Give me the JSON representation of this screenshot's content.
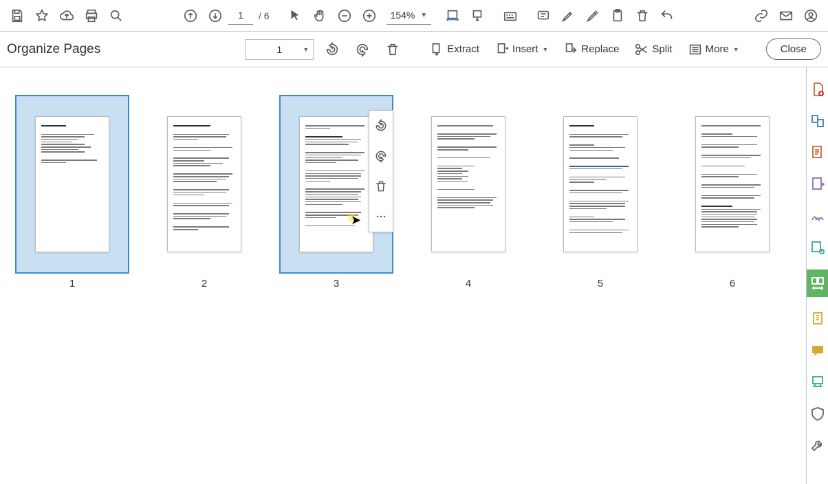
{
  "top_toolbar": {
    "page_input": "1",
    "page_total": "/ 6",
    "zoom_value": "154%"
  },
  "organize": {
    "title": "Organize Pages",
    "page_select_value": "1",
    "buttons": {
      "extract": "Extract",
      "insert": "Insert",
      "replace": "Replace",
      "split": "Split",
      "more": "More"
    },
    "close": "Close"
  },
  "thumbs": {
    "p1": "1",
    "p2": "2",
    "p3": "3",
    "p4": "4",
    "p5": "5",
    "p6": "6"
  },
  "icons": {
    "save": "save-icon",
    "star": "star-icon",
    "cloud_upload": "cloud-upload-icon",
    "print": "printer-icon",
    "search": "search-icon",
    "page_up": "arrow-up-circle-icon",
    "page_down": "arrow-down-circle-icon",
    "pointer": "pointer-icon",
    "hand": "hand-icon",
    "zoom_out": "zoom-out-icon",
    "zoom_in": "zoom-in-icon",
    "fit_width": "fit-width-icon",
    "fit_page": "fit-page-icon",
    "typewriter": "keyboard-icon",
    "note": "note-icon",
    "highlight": "highlight-icon",
    "eraser": "eraser-icon",
    "clipboard": "clipboard-icon",
    "trash": "trash-icon",
    "undo": "undo-icon",
    "link": "link-icon",
    "mail": "mail-icon",
    "account": "account-icon",
    "rotate_ccw": "rotate-ccw-icon",
    "rotate_cw": "rotate-cw-icon",
    "scissors": "scissors-icon",
    "list": "list-icon",
    "dots": "dots-icon"
  }
}
